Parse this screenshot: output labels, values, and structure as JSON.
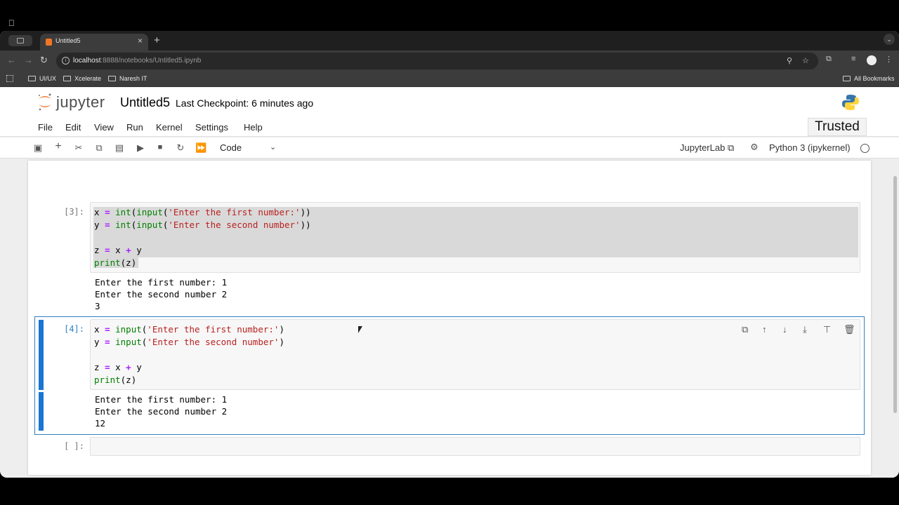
{
  "browser": {
    "tab_title": "Untitled5",
    "url_host": "localhost",
    "url_rest": ":8888/notebooks/Untitled5.ipynb",
    "bookmarks": [
      "UI/UX",
      "Xcelerate",
      "Naresh IT"
    ],
    "all_bookmarks": "All Bookmarks"
  },
  "jupyter": {
    "logo_text": "jupyter",
    "notebook_name": "Untitled5",
    "checkpoint": "Last Checkpoint: 6 minutes ago",
    "menu": [
      "File",
      "Edit",
      "View",
      "Run",
      "Kernel",
      "Settings",
      "Help"
    ],
    "trusted": "Trusted",
    "cell_type": "Code",
    "jupyterlab_label": "JupyterLab",
    "kernel_name": "Python 3 (ipykernel)"
  },
  "cells": [
    {
      "prompt": "[3]:",
      "code": [
        "x = int(input('Enter the first number:'))",
        "y = int(input('Enter the second number'))",
        "",
        "z = x + y",
        "print(z)"
      ],
      "output": [
        "Enter the first number: 1",
        "Enter the second number 2",
        "3"
      ]
    },
    {
      "prompt": "[4]:",
      "code": [
        "x = input('Enter the first number:')",
        "y = input('Enter the second number')",
        "",
        "z = x + y",
        "print(z)"
      ],
      "output": [
        "Enter the first number: 1",
        "Enter the second number 2",
        "12"
      ]
    },
    {
      "prompt": "[ ]:",
      "code": [],
      "output": []
    }
  ],
  "icons": {
    "toolbar": [
      "save-icon",
      "add-cell-icon",
      "cut-icon",
      "copy-icon",
      "paste-icon",
      "run-icon",
      "stop-icon",
      "restart-icon",
      "run-all-icon"
    ],
    "cell_tools": [
      "duplicate-icon",
      "move-up-icon",
      "move-down-icon",
      "insert-below-icon",
      "insert-above-icon",
      "delete-icon"
    ]
  },
  "colors": {
    "jupyter_orange": "#f37626",
    "active_blue": "#1976d2"
  }
}
